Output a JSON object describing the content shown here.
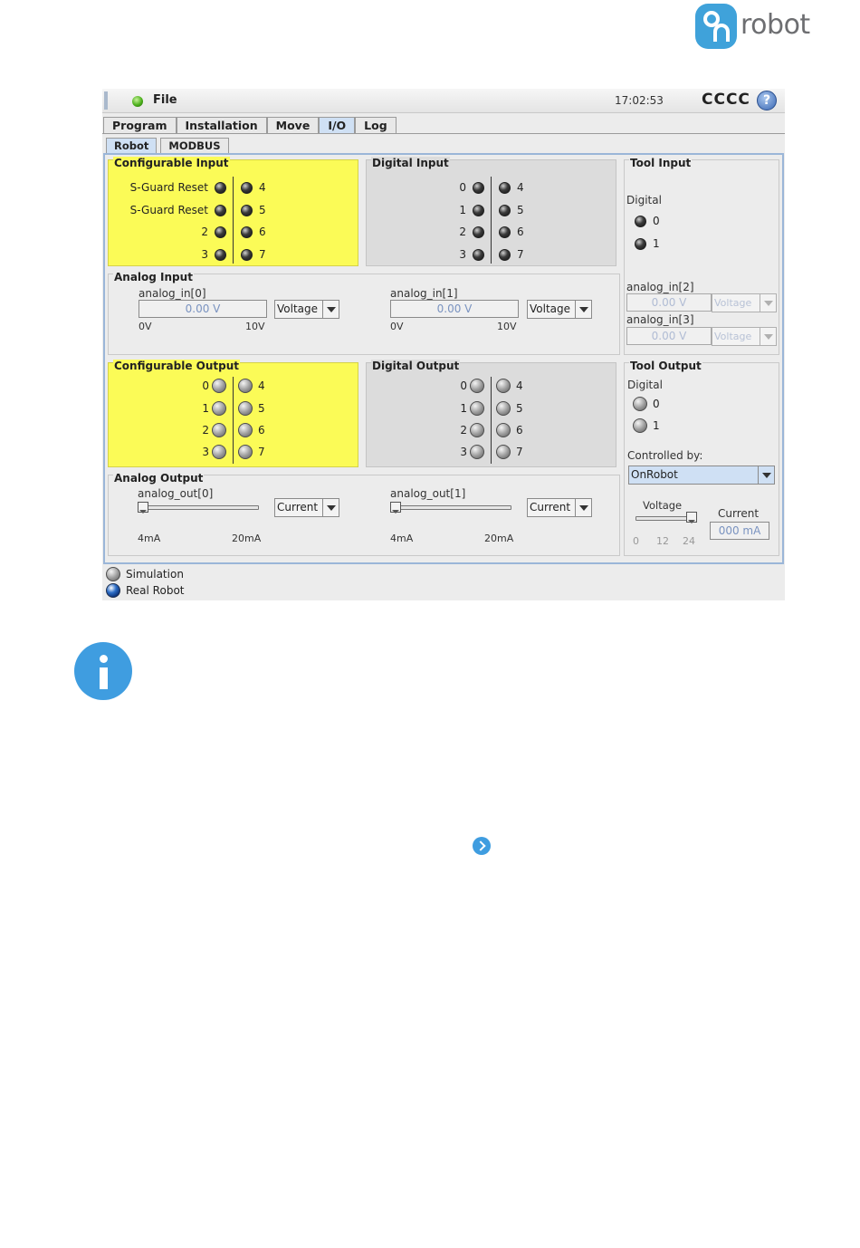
{
  "brand": {
    "logo_text": "robot",
    "logo_mark": "On"
  },
  "titlebar": {
    "file_label": "File",
    "clock": "17:02:53",
    "robot_name": "CCCC",
    "help": "?"
  },
  "tabs": [
    {
      "label": "Program"
    },
    {
      "label": "Installation"
    },
    {
      "label": "Move"
    },
    {
      "label": "I/O",
      "active": true
    },
    {
      "label": "Log"
    }
  ],
  "subtabs": [
    {
      "label": "Robot",
      "active": true
    },
    {
      "label": "MODBUS"
    }
  ],
  "configurable_input": {
    "title": "Configurable Input",
    "left": [
      "S-Guard Reset",
      "S-Guard Reset",
      "2",
      "3"
    ],
    "right": [
      "4",
      "5",
      "6",
      "7"
    ]
  },
  "digital_input": {
    "title": "Digital Input",
    "left": [
      "0",
      "1",
      "2",
      "3"
    ],
    "right": [
      "4",
      "5",
      "6",
      "7"
    ]
  },
  "tool_input": {
    "title": "Tool Input",
    "digital_label": "Digital",
    "pins": [
      "0",
      "1"
    ],
    "analog": [
      {
        "name": "analog_in[2]",
        "value": "0.00 V",
        "mode": "Voltage"
      },
      {
        "name": "analog_in[3]",
        "value": "0.00 V",
        "mode": "Voltage"
      }
    ]
  },
  "analog_input": {
    "title": "Analog Input",
    "channels": [
      {
        "name": "analog_in[0]",
        "value": "0.00 V",
        "mode": "Voltage",
        "min": "0V",
        "max": "10V"
      },
      {
        "name": "analog_in[1]",
        "value": "0.00 V",
        "mode": "Voltage",
        "min": "0V",
        "max": "10V"
      }
    ]
  },
  "configurable_output": {
    "title": "Configurable Output",
    "left": [
      "0",
      "1",
      "2",
      "3"
    ],
    "right": [
      "4",
      "5",
      "6",
      "7"
    ]
  },
  "digital_output": {
    "title": "Digital Output",
    "left": [
      "0",
      "1",
      "2",
      "3"
    ],
    "right": [
      "4",
      "5",
      "6",
      "7"
    ]
  },
  "tool_output": {
    "title": "Tool Output",
    "digital_label": "Digital",
    "pins": [
      "0",
      "1"
    ],
    "controlled_by_label": "Controlled by:",
    "controlled_by_value": "OnRobot",
    "voltage_label": "Voltage",
    "voltage_ticks": [
      "0",
      "12",
      "24"
    ],
    "voltage_value": 24,
    "current_label": "Current",
    "current_value": "000 mA"
  },
  "analog_output": {
    "title": "Analog Output",
    "channels": [
      {
        "name": "analog_out[0]",
        "mode": "Current",
        "min": "4mA",
        "max": "20mA",
        "level": 0
      },
      {
        "name": "analog_out[1]",
        "mode": "Current",
        "min": "4mA",
        "max": "20mA",
        "level": 0
      }
    ]
  },
  "footer": {
    "simulation": "Simulation",
    "real_robot": "Real Robot"
  },
  "colors": {
    "highlight_yellow": "#fbfb57",
    "accent_blue": "#3f9de0",
    "tab_active": "#cfe0f4"
  }
}
